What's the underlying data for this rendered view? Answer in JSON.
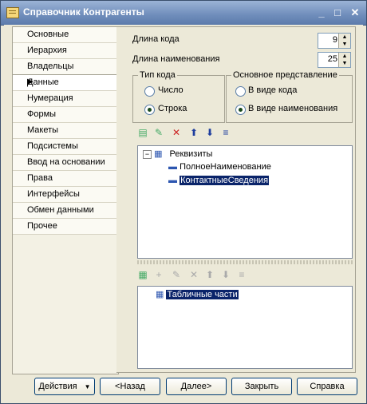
{
  "window": {
    "title": "Справочник Контрагенты",
    "min_glyph": "_",
    "max_glyph": "□",
    "close_glyph": "✕"
  },
  "nav": {
    "items": [
      "Основные",
      "Иерархия",
      "Владельцы",
      "Данные",
      "Нумерация",
      "Формы",
      "Макеты",
      "Подсистемы",
      "Ввод на основании",
      "Права",
      "Интерфейсы",
      "Обмен данными",
      "Прочее"
    ],
    "active_index": 3,
    "active_marker": "▶"
  },
  "code_length": {
    "label": "Длина кода",
    "value": "9"
  },
  "name_length": {
    "label": "Длина наименования",
    "value": "25"
  },
  "code_type": {
    "legend": "Тип кода",
    "options": [
      "Число",
      "Строка"
    ],
    "selected": "Строка"
  },
  "main_view": {
    "legend": "Основное представление",
    "options": [
      "В виде кода",
      "В виде наименования"
    ],
    "selected": "В виде наименования"
  },
  "requisites_tree": {
    "root": "Реквизиты",
    "children": [
      "ПолноеНаименование",
      "КонтактныеСведения"
    ],
    "selected": "КонтактныеСведения"
  },
  "tables_tree": {
    "root": "Табличные части"
  },
  "buttons": {
    "actions": "Действия",
    "back": "<Назад",
    "next": "Далее>",
    "close": "Закрыть",
    "help": "Справка"
  }
}
